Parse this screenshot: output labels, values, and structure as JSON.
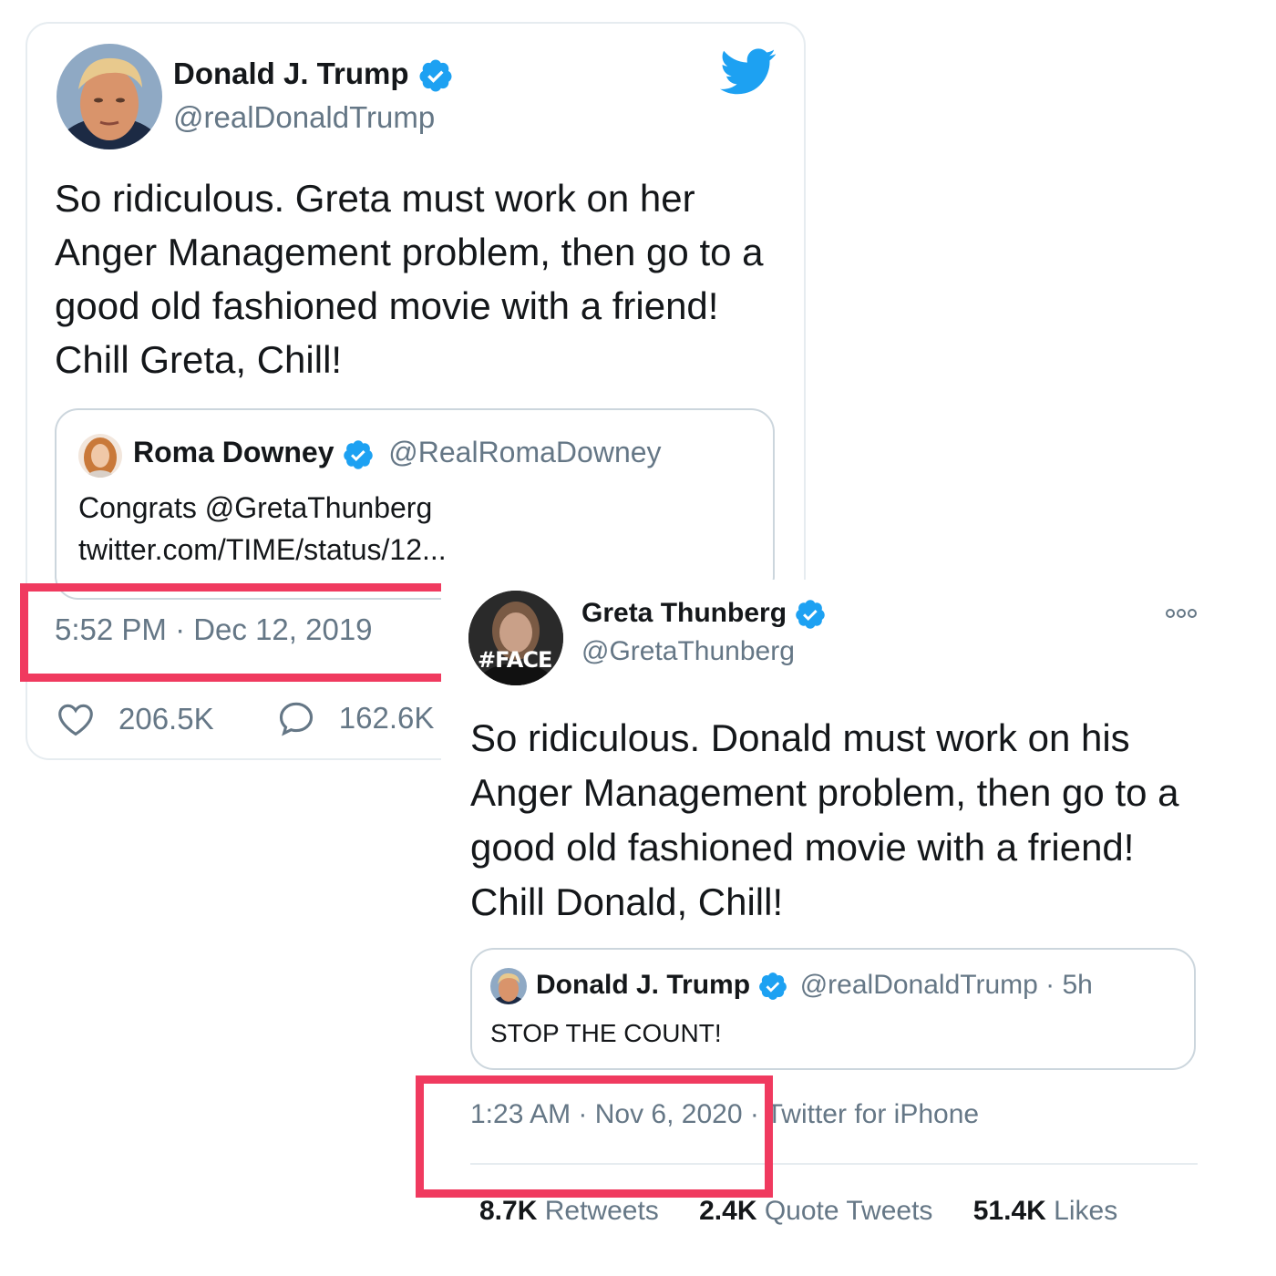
{
  "colors": {
    "twitter_blue": "#1da1f2",
    "text_primary": "#14171a",
    "text_secondary": "#657786",
    "highlight_red": "#f03a5f",
    "border": "#ccd6dd"
  },
  "tweet1": {
    "author_name": "Donald J. Trump",
    "author_handle": "@realDonaldTrump",
    "verified_icon": "verified-badge-icon",
    "logo_icon": "twitter-bird-icon",
    "text": "So ridiculous. Greta must work on her Anger Management problem, then go to a good old fashioned movie with a friend! Chill Greta, Chill!",
    "quoted": {
      "author_name": "Roma Downey",
      "author_handle": "@RealRomaDowney",
      "text_line1": "Congrats @GretaThunberg",
      "text_line2": "twitter.com/TIME/status/12..."
    },
    "timestamp": "5:52 PM · Dec 12, 2019",
    "likes": "206.5K",
    "replies": "162.6K",
    "like_icon": "heart-icon",
    "reply_icon": "reply-bubble-icon"
  },
  "tweet2": {
    "author_name": "Greta Thunberg",
    "author_handle": "@GretaThunberg",
    "avatar_label": "#FACE",
    "more_icon": "more-options-icon",
    "text": "So ridiculous. Donald must work on his Anger Management problem, then go to a good old fashioned movie with a friend! Chill Donald, Chill!",
    "quoted": {
      "author_name": "Donald J. Trump",
      "author_handle": "@realDonaldTrump · 5h",
      "text": "STOP THE COUNT!"
    },
    "timestamp": "1:23 AM · Nov 6, 2020 ·",
    "source": "Twitter for iPhone",
    "retweets_count": "8.7K",
    "retweets_label": "Retweets",
    "quote_tweets_count": "2.4K",
    "quote_tweets_label": "Quote Tweets",
    "likes_count": "51.4K",
    "likes_label": "Likes"
  }
}
